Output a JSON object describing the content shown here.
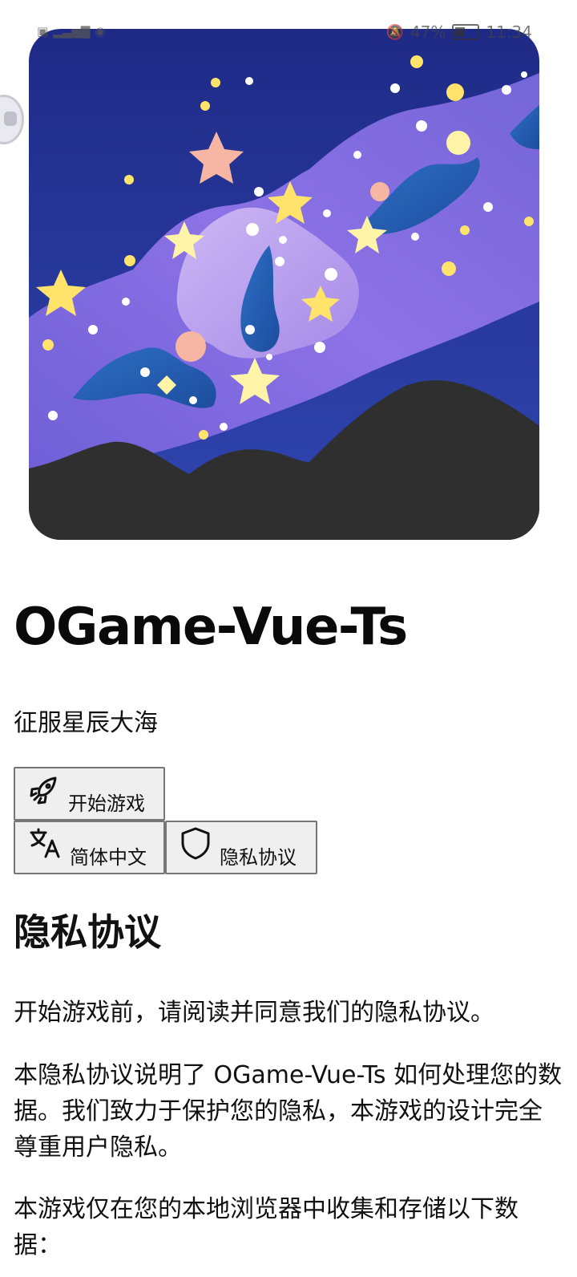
{
  "status_bar": {
    "battery": "47%",
    "time": "11:34"
  },
  "app": {
    "title": "OGame-Vue-Ts",
    "slogan": "征服星辰大海"
  },
  "buttons": {
    "start": {
      "label": "开始游戏",
      "icon": "rocket-icon"
    },
    "language": {
      "label": "简体中文",
      "icon": "translate-icon"
    },
    "privacy": {
      "label": "隐私协议",
      "icon": "shield-icon"
    }
  },
  "privacy": {
    "heading": "隐私协议",
    "paragraphs": [
      "开始游戏前，请阅读并同意我们的隐私协议。",
      "本隐私协议说明了 OGame-Vue-Ts 如何处理您的数据。我们致力于保护您的隐私，本游戏的设计完全尊重用户隐私。",
      "本游戏仅在您的本地浏览器中收集和存储以下数据："
    ]
  },
  "colors": {
    "sky": "#2b3b9e",
    "milky_way": "#7d68d8",
    "mountain": "#2f2f2f",
    "star_yellow": "#ffe36b",
    "star_pink": "#f7b6a3"
  }
}
